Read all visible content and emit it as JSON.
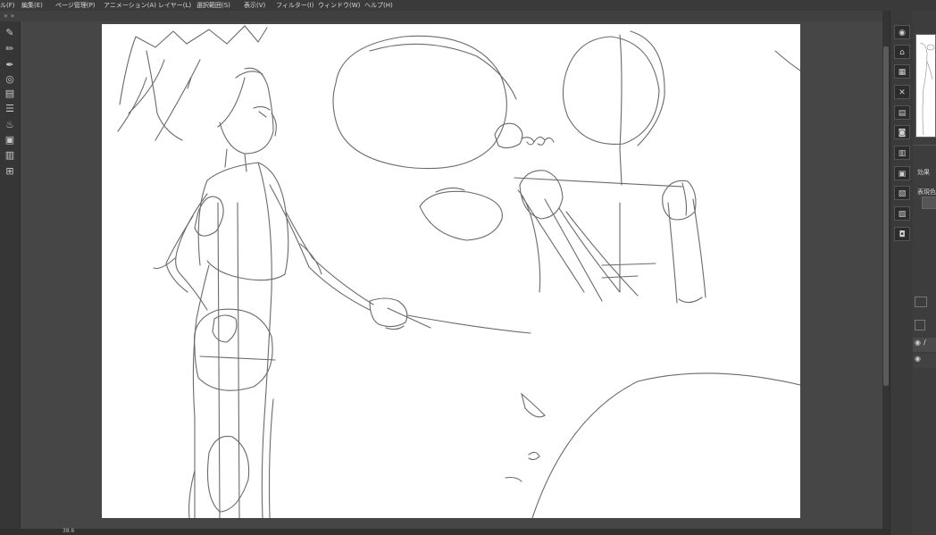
{
  "menu": {
    "items": [
      "ル(F)",
      "編集(E)",
      "ページ管理(P)",
      "アニメーション(A)",
      "レイヤー(L)",
      "選択範囲(S)",
      "表示(V)",
      "フィルター(I)",
      "ウィンドウ(W)",
      "ヘルプ(H)"
    ]
  },
  "subbar": {
    "left_arrows": "« »",
    "right_arrows": "« »"
  },
  "left_toolbar": {
    "icons": [
      "pen-layer-icon",
      "pencil-layer-icon",
      "brush-layer-icon",
      "circle-tool-icon",
      "layer-list-icon",
      "layer-stack-icon",
      "fill-icon",
      "panel-icon",
      "layer-icon",
      "grid-icon"
    ]
  },
  "right_toolbar": {
    "icons": [
      "navigator-icon",
      "layer-property-icon",
      "layer-settings-icon",
      "delete-icon",
      "folder-icon",
      "camera-icon",
      "layers-icon",
      "save-icon",
      "book-icon",
      "page-icon",
      "copy-icon"
    ]
  },
  "right_panel": {
    "effect_label": "効果",
    "display_color_label": "表現色"
  },
  "status": {
    "zoom": "38.6"
  },
  "colors": {
    "menubar": "#3a3a3a",
    "canvas_bg": "#464646",
    "page": "#ffffff",
    "stroke": "#6a6a6a"
  }
}
